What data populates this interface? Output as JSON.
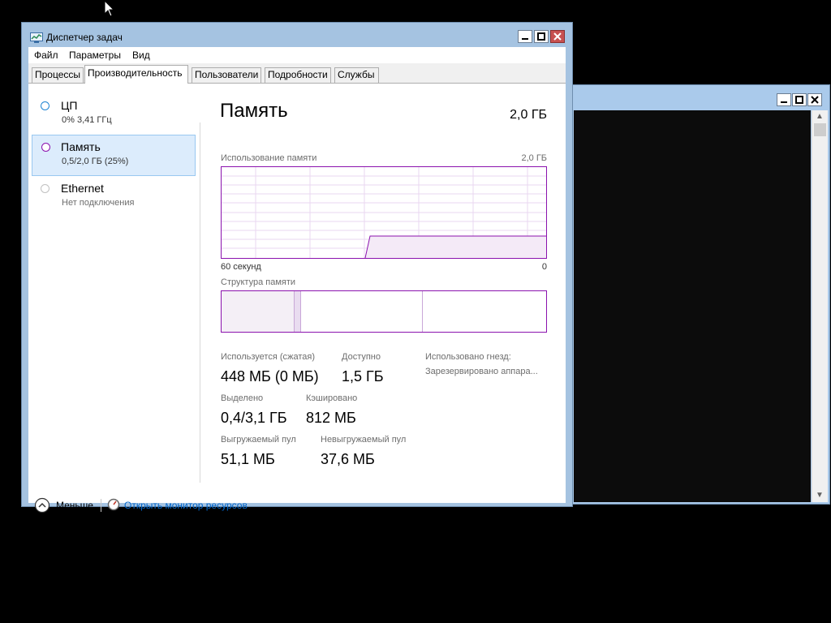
{
  "window": {
    "title": "Диспетчер задач",
    "menu": [
      "Файл",
      "Параметры",
      "Вид"
    ],
    "tabs": [
      "Процессы",
      "Производительность",
      "Пользователи",
      "Подробности",
      "Службы"
    ],
    "active_tab": "Производительность"
  },
  "sidebar": {
    "items": [
      {
        "name": "ЦП",
        "detail": "0% 3,41 ГГц",
        "selected": false
      },
      {
        "name": "Память",
        "detail": "0,5/2,0 ГБ (25%)",
        "selected": true
      },
      {
        "name": "Ethernet",
        "detail": "Нет подключения",
        "selected": false
      }
    ]
  },
  "memory": {
    "title": "Память",
    "total": "2,0 ГБ",
    "usage_label": "Использование памяти",
    "usage_max": "2,0 ГБ",
    "axis_left": "60 секунд",
    "axis_right": "0",
    "structure_label": "Структура памяти",
    "stats": {
      "in_use_label": "Используется (сжатая)",
      "in_use_value": "448 МБ (0 МБ)",
      "available_label": "Доступно",
      "available_value": "1,5 ГБ",
      "slots_label": "Использовано гнезд:",
      "reserved_label": "Зарезервировано аппара...",
      "committed_label": "Выделено",
      "committed_value": "0,4/3,1 ГБ",
      "cached_label": "Кэшировано",
      "cached_value": "812 МБ",
      "paged_label": "Выгружаемый пул",
      "paged_value": "51,1 МБ",
      "nonpaged_label": "Невыгружаемый пул",
      "nonpaged_value": "37,6 МБ"
    }
  },
  "footer": {
    "fewer_details": "Меньше",
    "open_resmon": "Открыть монитор ресурсов"
  },
  "colors": {
    "memory_accent": "#8b12ae",
    "cpu_accent": "#1e84d2",
    "link": "#0066cc"
  }
}
